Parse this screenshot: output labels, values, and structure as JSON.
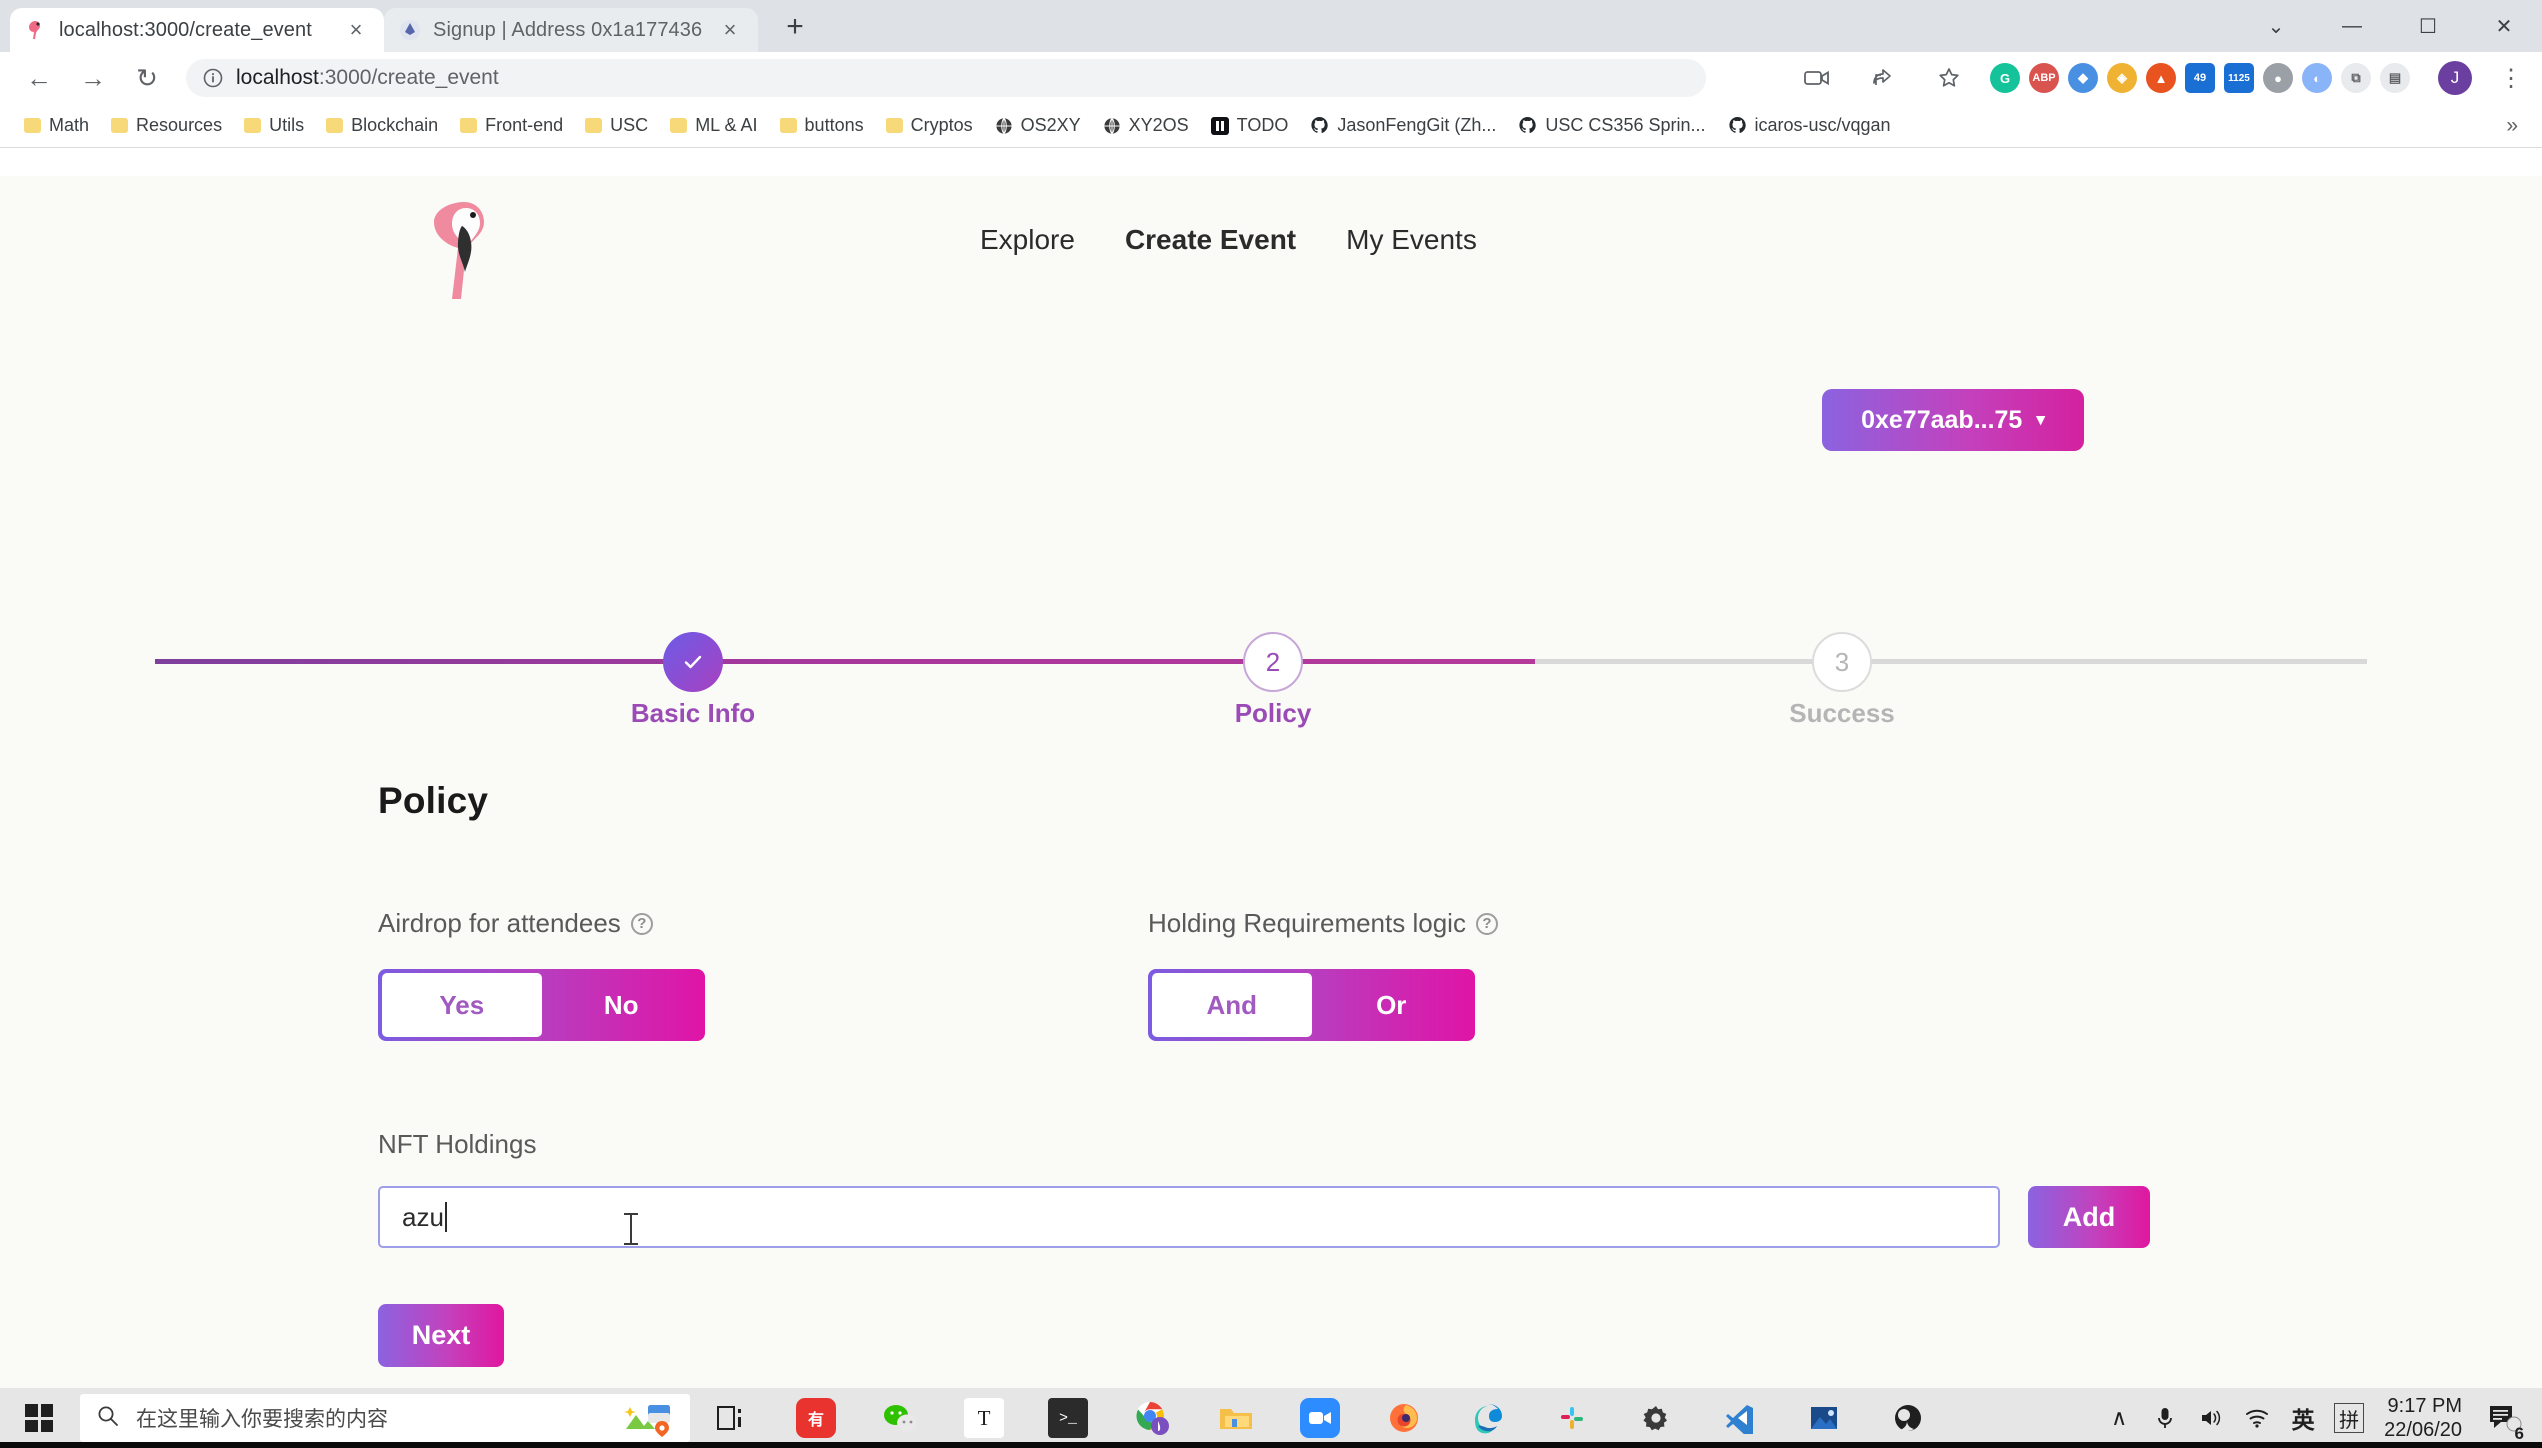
{
  "browser": {
    "tabs": [
      {
        "title": "localhost:3000/create_event",
        "favicon": "flamingo-icon",
        "active": true,
        "close_label": "×"
      },
      {
        "title": "Signup | Address 0x1a177436 ",
        "favicon": "wallet-icon",
        "active": false,
        "close_label": "×"
      }
    ],
    "new_tab_label": "+",
    "window_controls": {
      "minimize": "—",
      "maximize": "☐",
      "close": "✕",
      "more": "⌄"
    },
    "toolbar": {
      "back": "←",
      "forward": "→",
      "reload": "↻",
      "site_info_icon": "info-circle-icon",
      "url_host": "localhost",
      "url_path": ":3000/create_event",
      "video_icon": "camera-icon",
      "share_icon": "share-icon",
      "bookmark_icon": "star-icon",
      "profile_initial": "J",
      "menu_icon": "⋮",
      "extensions": [
        {
          "name": "grammarly-ext",
          "label": "G",
          "color": "#15c39a",
          "shape": "circle"
        },
        {
          "name": "adblock-ext",
          "label": "ABP",
          "color": "#d9534f",
          "shape": "circle"
        },
        {
          "name": "metamask-ext",
          "label": "⬢",
          "color": "#3b82f6",
          "shape": "circle"
        },
        {
          "name": "phantom-ext",
          "label": "◆",
          "color": "#f0b232",
          "shape": "circle"
        },
        {
          "name": "brave-ext",
          "label": "▲",
          "color": "#e8531f",
          "shape": "circle"
        },
        {
          "name": "proxy-ext-49",
          "label": "49",
          "color": "#1a6fd4",
          "shape": "square"
        },
        {
          "name": "proxy-ext-1125",
          "label": "1125",
          "color": "#1a6fd4",
          "shape": "square"
        },
        {
          "name": "wallet-ext",
          "label": "●",
          "color": "#9aa0a6",
          "shape": "circle"
        },
        {
          "name": "translate-ext",
          "label": "◐",
          "color": "#8ab4f8",
          "shape": "circle"
        },
        {
          "name": "puzzle-ext",
          "label": "⧉",
          "color": "#5f6368",
          "shape": "circle"
        },
        {
          "name": "sidepanel-ext",
          "label": "▧",
          "color": "#5f6368",
          "shape": "circle"
        }
      ]
    },
    "bookmarks": [
      {
        "label": "Math",
        "icon": "folder-icon"
      },
      {
        "label": "Resources",
        "icon": "folder-icon"
      },
      {
        "label": "Utils",
        "icon": "folder-icon"
      },
      {
        "label": "Blockchain",
        "icon": "folder-icon"
      },
      {
        "label": "Front-end",
        "icon": "folder-icon"
      },
      {
        "label": "USC",
        "icon": "folder-icon"
      },
      {
        "label": "ML & AI",
        "icon": "folder-icon"
      },
      {
        "label": "buttons",
        "icon": "folder-icon"
      },
      {
        "label": "Cryptos",
        "icon": "folder-icon"
      },
      {
        "label": "OS2XY",
        "icon": "globe-icon"
      },
      {
        "label": "XY2OS",
        "icon": "globe-icon"
      },
      {
        "label": "TODO",
        "icon": "notion-icon"
      },
      {
        "label": "JasonFengGit (Zh...",
        "icon": "github-icon"
      },
      {
        "label": "USC CS356 Sprin...",
        "icon": "github-icon"
      },
      {
        "label": "icaros-usc/vqgan",
        "icon": "github-icon"
      }
    ],
    "bookmarks_overflow": "»"
  },
  "site": {
    "logo_name": "flamingo-logo",
    "nav": [
      {
        "label": "Explore",
        "current": false
      },
      {
        "label": "Create Event",
        "current": true
      },
      {
        "label": "My Events",
        "current": false
      }
    ],
    "wallet": {
      "address": "0xe77aab...75",
      "caret": "▾"
    }
  },
  "stepper": {
    "steps": [
      {
        "num": "✓",
        "label": "Basic Info",
        "state": "done"
      },
      {
        "num": "2",
        "label": "Policy",
        "state": "active"
      },
      {
        "num": "3",
        "label": "Success",
        "state": "todo"
      }
    ]
  },
  "form": {
    "title": "Policy",
    "airdrop": {
      "label": "Airdrop for attendees",
      "help": "?",
      "options": [
        {
          "label": "Yes",
          "selected": true
        },
        {
          "label": "No",
          "selected": false
        }
      ]
    },
    "holding_logic": {
      "label": "Holding Requirements logic",
      "help": "?",
      "options": [
        {
          "label": "And",
          "selected": true
        },
        {
          "label": "Or",
          "selected": false
        }
      ]
    },
    "nft_holdings": {
      "label": "NFT Holdings",
      "value": "azu",
      "placeholder": "",
      "add_label": "Add"
    },
    "next_label": "Next"
  },
  "taskbar": {
    "start_name": "windows-start-icon",
    "search_placeholder": "在这里输入你要搜索的内容",
    "search_icon": "search-icon",
    "cortana_icon": "people-map-icon",
    "apps": [
      {
        "name": "task-view-icon",
        "glyph": "⧉",
        "color": "#1f1f1f",
        "running": false
      },
      {
        "name": "youdao-icon",
        "glyph": "有",
        "color": "#ffffff",
        "bg": "#e8332e",
        "running": false
      },
      {
        "name": "wechat-icon",
        "glyph": "●",
        "color": "#2dc100",
        "running": false
      },
      {
        "name": "typora-icon",
        "glyph": "T",
        "color": "#1f1f1f",
        "running": true
      },
      {
        "name": "terminal-icon",
        "glyph": "❯_",
        "color": "#ffffff",
        "bg": "#2b2b2b",
        "running": true
      },
      {
        "name": "chrome-icon",
        "glyph": "◉",
        "color": "#4285f4",
        "running": true
      },
      {
        "name": "file-explorer-icon",
        "glyph": "▱",
        "color": "#f5b642",
        "running": true
      },
      {
        "name": "zoom-icon",
        "glyph": "▤",
        "color": "#ffffff",
        "bg": "#2d8cff",
        "running": true
      },
      {
        "name": "firefox-icon",
        "glyph": "◉",
        "color": "#ff7139",
        "running": false
      },
      {
        "name": "edge-icon",
        "glyph": "◔",
        "color": "#0d8bd9",
        "running": false
      },
      {
        "name": "slack-icon",
        "glyph": "✻",
        "color": "#e01e5a",
        "running": true
      },
      {
        "name": "settings-icon",
        "glyph": "⚙",
        "color": "#3a3a3a",
        "running": true
      },
      {
        "name": "vscode-icon",
        "glyph": "✕",
        "color": "#2f80d0",
        "running": true
      },
      {
        "name": "photos-icon",
        "glyph": "◰",
        "color": "#1a4a8a",
        "running": true
      },
      {
        "name": "obs-icon",
        "glyph": "◑",
        "color": "#1f1f1f",
        "running": true
      }
    ],
    "tray": {
      "caret": "∧",
      "mic_icon": "microphone-icon",
      "volume_icon": "speaker-icon",
      "wifi_icon": "wifi-icon",
      "ime_lang": "英",
      "ime_mode": "拼",
      "time": "9:17 PM",
      "date": "22/06/20",
      "notification_icon": "notification-icon",
      "notification_count": "6"
    }
  }
}
